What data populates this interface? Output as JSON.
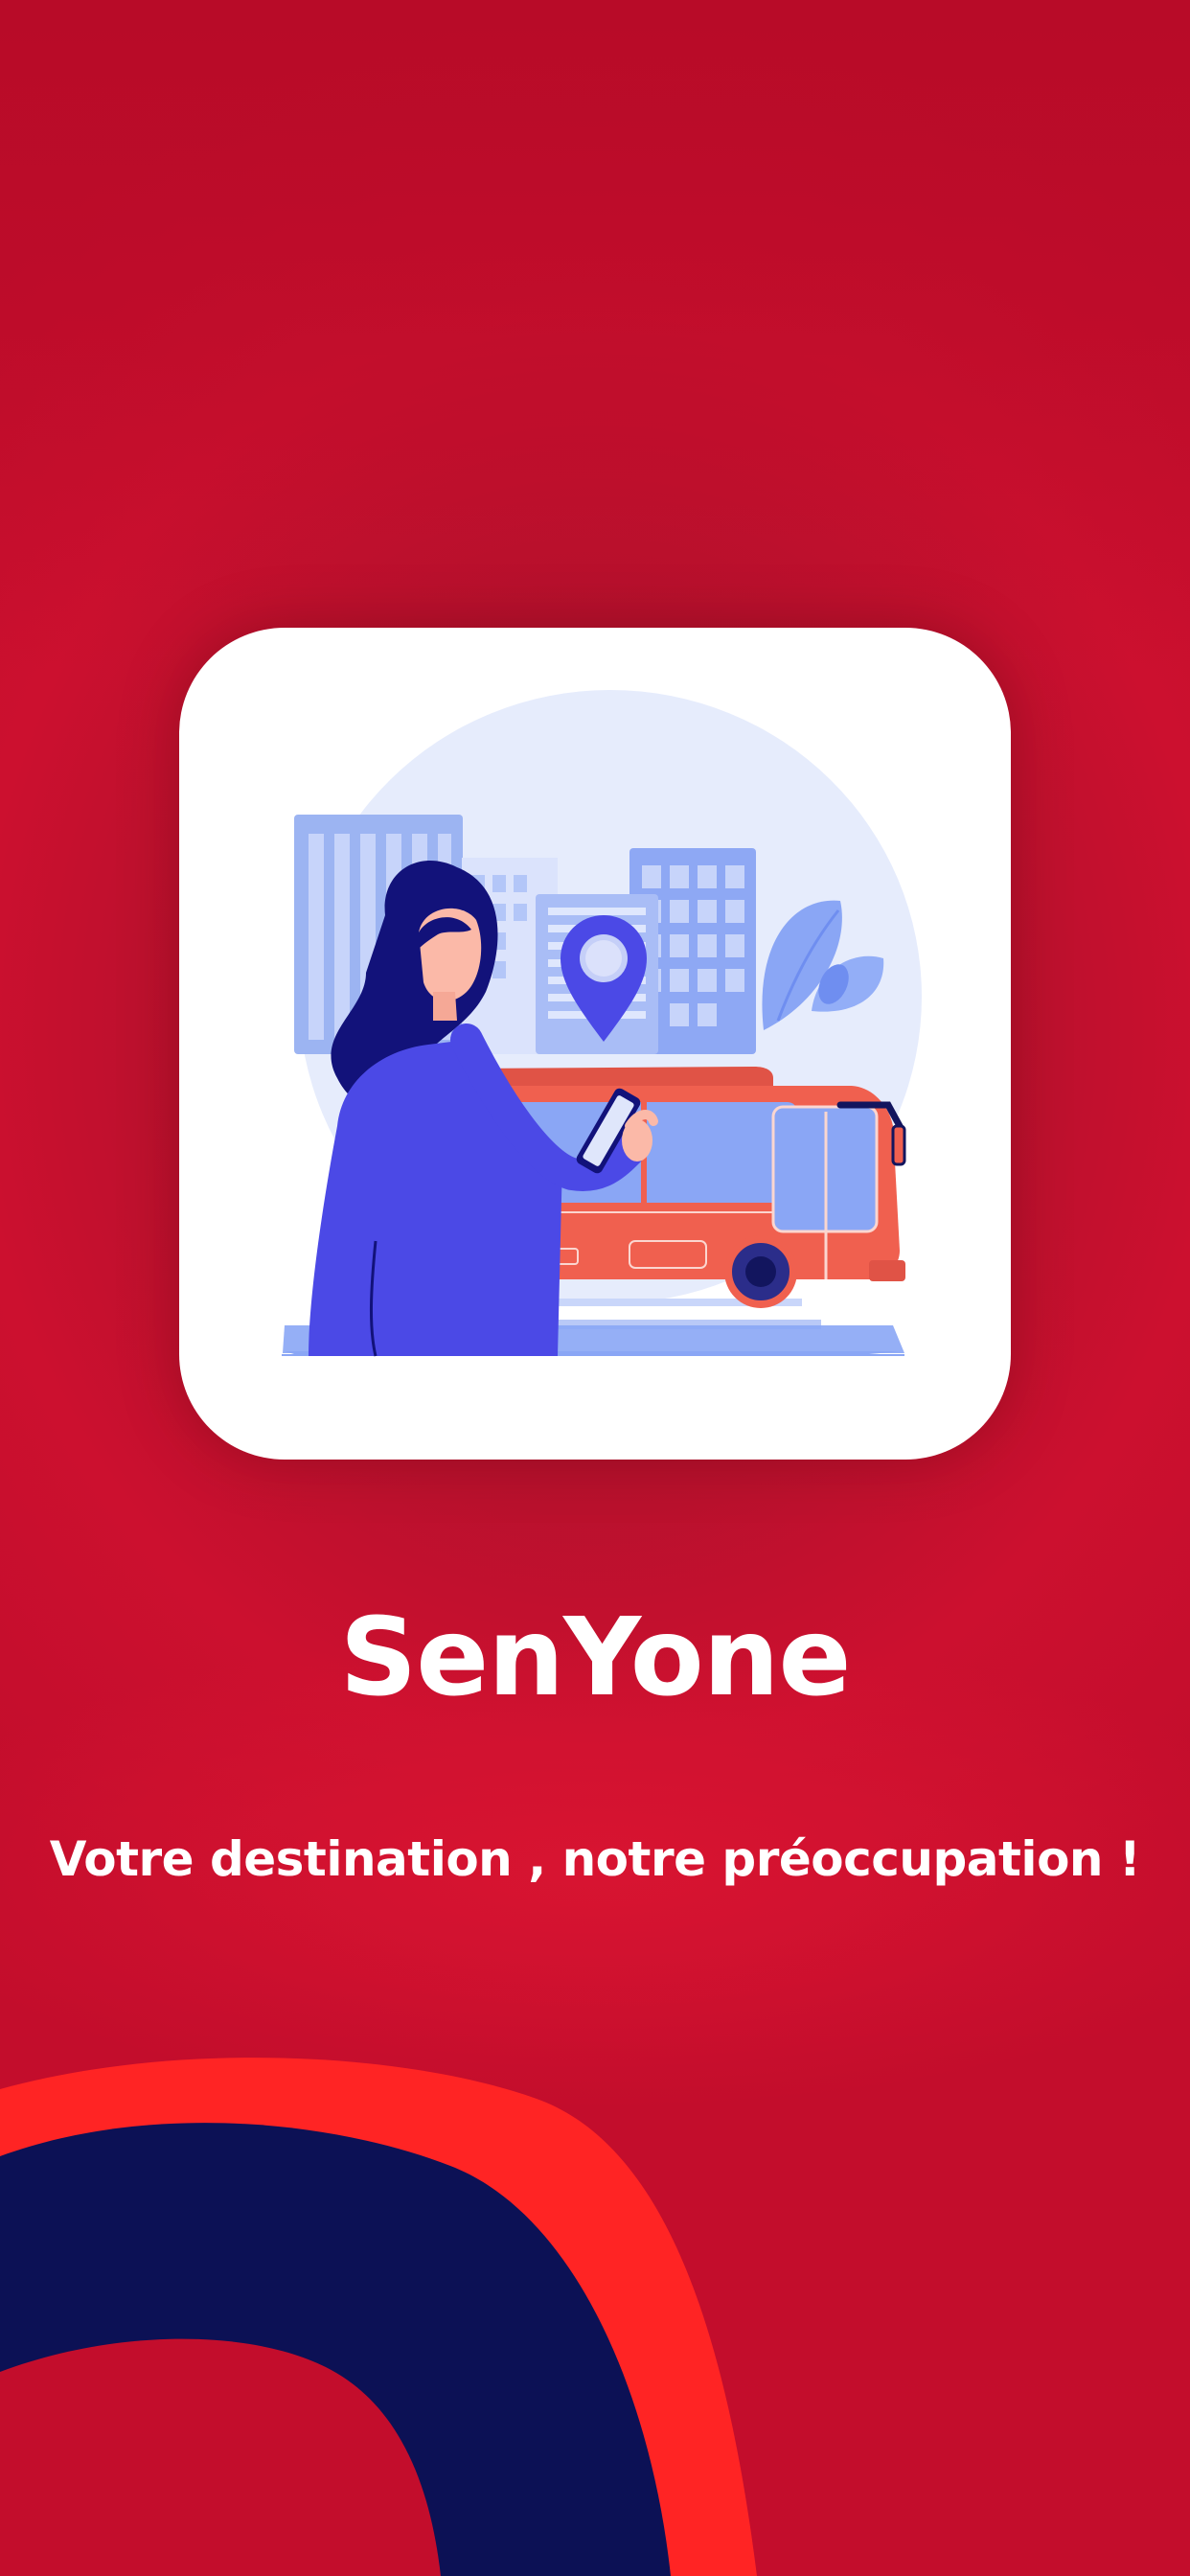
{
  "splash": {
    "app_name": "SenYone",
    "tagline": "Votre destination , notre préoccupation !",
    "icons": [
      "location-pin-icon"
    ]
  },
  "colors": {
    "background": "#c30d2c",
    "background_dark": "#a3132d",
    "card": "#ffffff",
    "text": "#ffffff",
    "accent_red": "#ff2424",
    "accent_navy": "#0c1155",
    "illustration_blue": "#8aa6f5",
    "illustration_purple": "#4b49e6",
    "bus_coral": "#f0604f"
  }
}
